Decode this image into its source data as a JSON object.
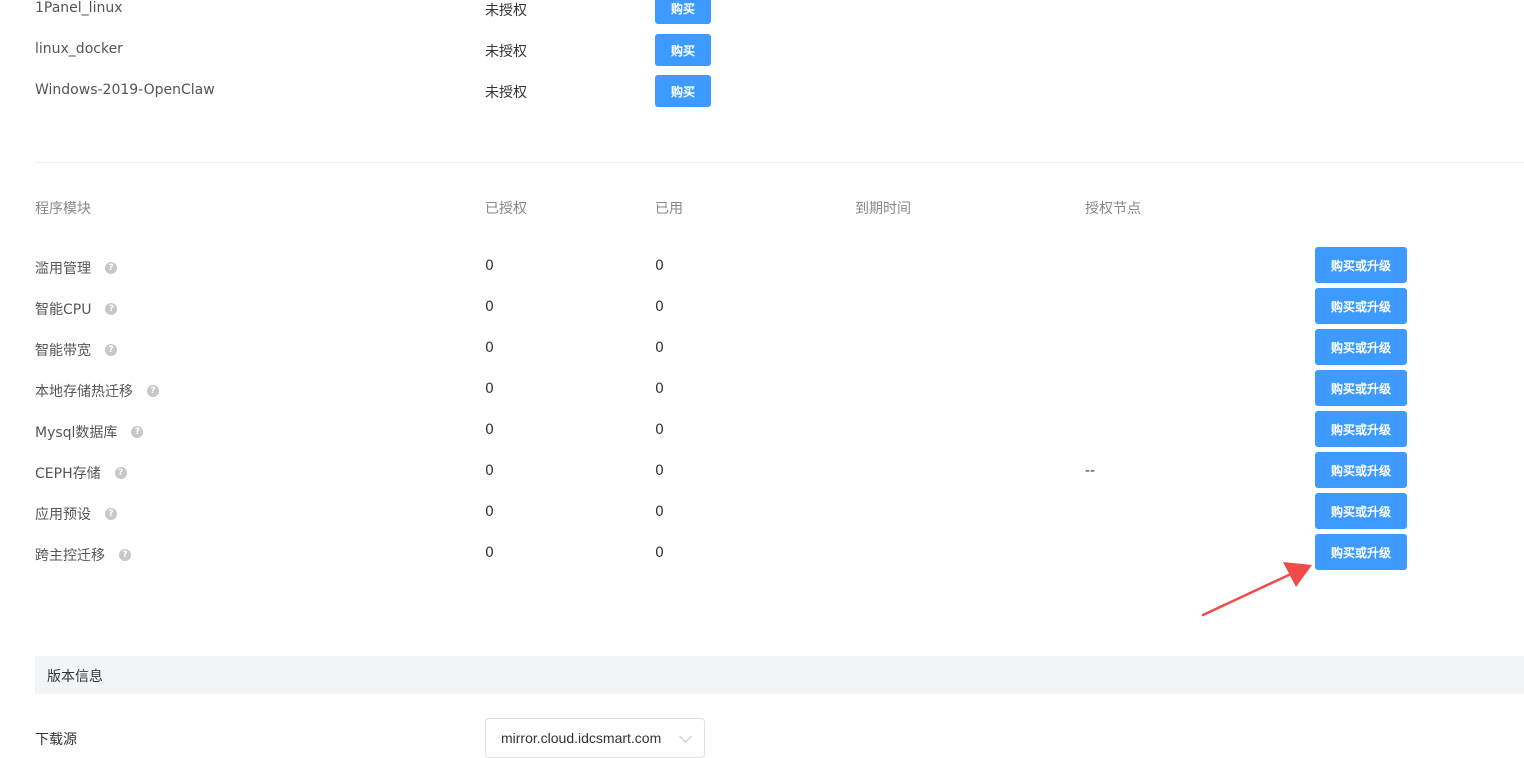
{
  "licenses": [
    {
      "name": "1Panel_linux",
      "status": "未授权",
      "button": "购买"
    },
    {
      "name": "linux_docker",
      "status": "未授权",
      "button": "购买"
    },
    {
      "name": "Windows-2019-OpenClaw",
      "status": "未授权",
      "button": "购买"
    }
  ],
  "modules_table": {
    "headers": [
      "程序模块",
      "已授权",
      "已用",
      "到期时间",
      "授权节点"
    ],
    "rows": [
      {
        "name": "滥用管理",
        "authorized": "0",
        "used": "0",
        "expiry": "",
        "node": "",
        "button": "购买或升级"
      },
      {
        "name": "智能CPU",
        "authorized": "0",
        "used": "0",
        "expiry": "",
        "node": "",
        "button": "购买或升级"
      },
      {
        "name": "智能带宽",
        "authorized": "0",
        "used": "0",
        "expiry": "",
        "node": "",
        "button": "购买或升级"
      },
      {
        "name": "本地存储热迁移",
        "authorized": "0",
        "used": "0",
        "expiry": "",
        "node": "",
        "button": "购买或升级"
      },
      {
        "name": "Mysql数据库",
        "authorized": "0",
        "used": "0",
        "expiry": "",
        "node": "",
        "button": "购买或升级"
      },
      {
        "name": "CEPH存储",
        "authorized": "0",
        "used": "0",
        "expiry": "",
        "node": "--",
        "button": "购买或升级"
      },
      {
        "name": "应用预设",
        "authorized": "0",
        "used": "0",
        "expiry": "",
        "node": "",
        "button": "购买或升级"
      },
      {
        "name": "跨主控迁移",
        "authorized": "0",
        "used": "0",
        "expiry": "",
        "node": "",
        "button": "购买或升级"
      }
    ],
    "help_icon": "question-circle-icon"
  },
  "version_section": {
    "title": "版本信息",
    "download_source_label": "下载源",
    "download_source_value": "mirror.cloud.idcsmart.com"
  },
  "annotation": {
    "arrow_color": "#f04a4a"
  },
  "colors": {
    "primary_button": "#3d9bff",
    "section_bg": "#f2f4f7"
  }
}
